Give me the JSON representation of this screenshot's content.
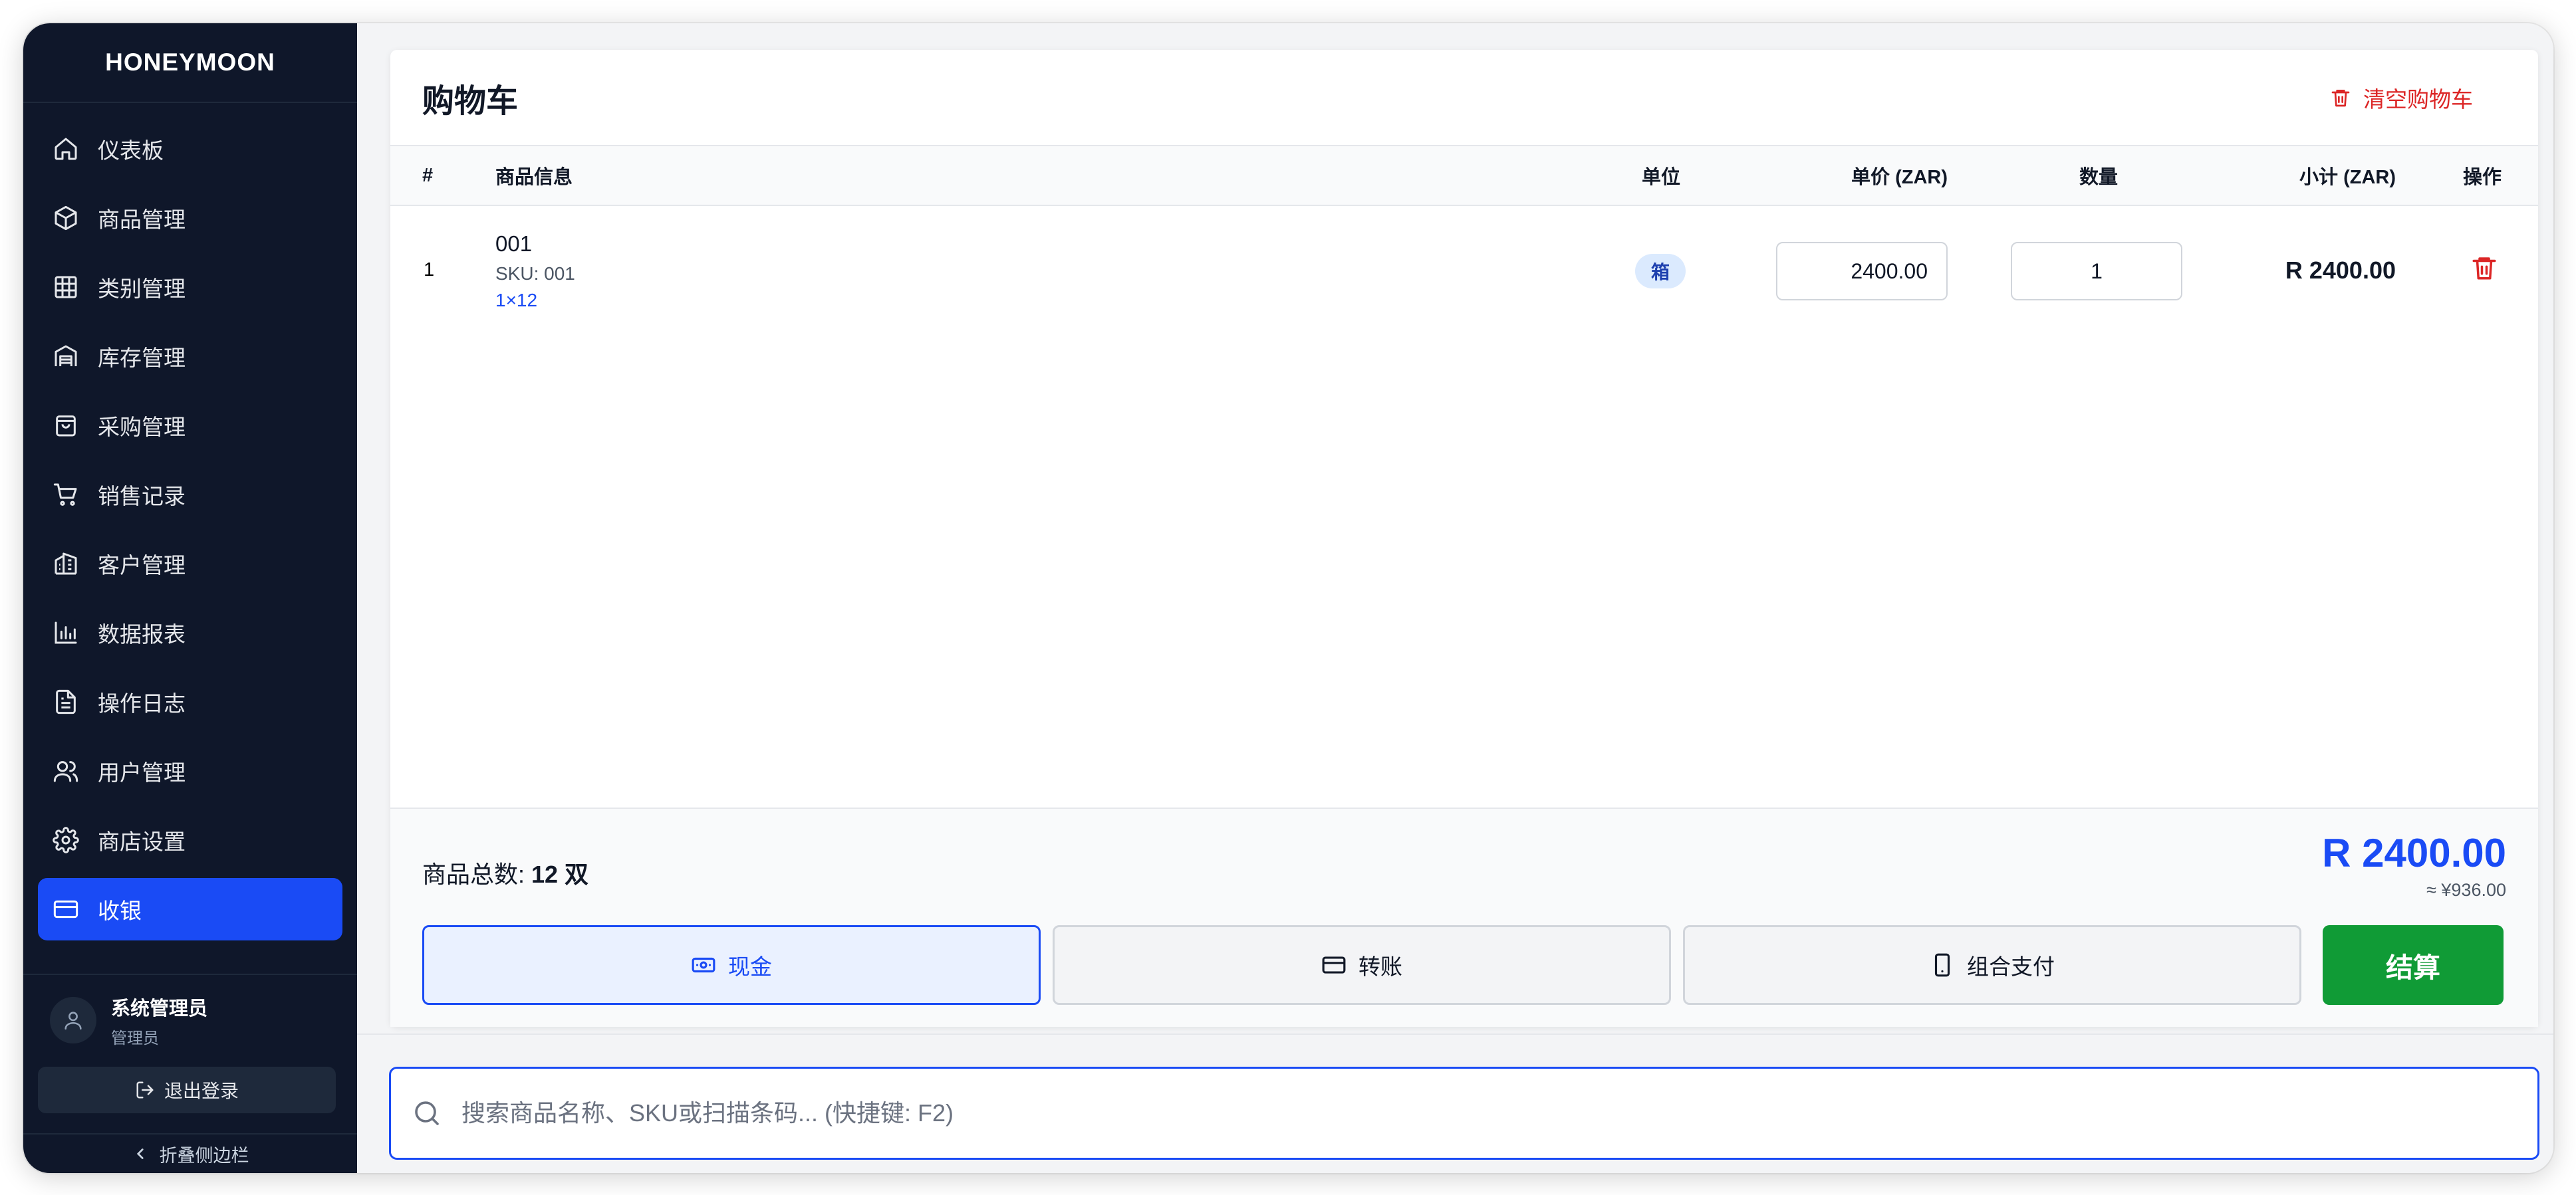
{
  "sidebar": {
    "brand": "HONEYMOON",
    "items": [
      {
        "label": "仪表板",
        "icon": "home-icon"
      },
      {
        "label": "商品管理",
        "icon": "box-icon"
      },
      {
        "label": "类别管理",
        "icon": "grid-icon"
      },
      {
        "label": "库存管理",
        "icon": "warehouse-icon"
      },
      {
        "label": "采购管理",
        "icon": "shopping-bag-icon"
      },
      {
        "label": "销售记录",
        "icon": "cart-icon"
      },
      {
        "label": "客户管理",
        "icon": "building-icon"
      },
      {
        "label": "数据报表",
        "icon": "bar-chart-icon"
      },
      {
        "label": "操作日志",
        "icon": "file-text-icon"
      },
      {
        "label": "用户管理",
        "icon": "users-icon"
      },
      {
        "label": "商店设置",
        "icon": "gear-icon"
      },
      {
        "label": "收银",
        "icon": "credit-card-icon",
        "active": true
      }
    ],
    "user": {
      "name": "系统管理员",
      "role": "管理员"
    },
    "logout_label": "退出登录",
    "collapse_label": "折叠侧边栏"
  },
  "cart": {
    "title": "购物车",
    "clear_label": "清空购物车",
    "columns": {
      "index": "#",
      "product": "商品信息",
      "unit": "单位",
      "price": "单价 (ZAR)",
      "quantity": "数量",
      "subtotal": "小计 (ZAR)",
      "action": "操作"
    },
    "rows": [
      {
        "index": "1",
        "name": "001",
        "sku": "SKU: 001",
        "pack": "1×12",
        "unit": "箱",
        "price": "2400.00",
        "quantity": "1",
        "subtotal": "R 2400.00"
      }
    ],
    "footer": {
      "count_label": "商品总数: ",
      "count_value": "12 双",
      "total": "R 2400.00",
      "total_cny": "≈ ¥936.00",
      "pay_methods": [
        "现金",
        "转账",
        "组合支付"
      ],
      "active_method": "现金",
      "checkout_label": "结算"
    }
  },
  "search": {
    "placeholder": "搜索商品名称、SKU或扫描条码... (快捷键: F2)",
    "value": ""
  },
  "colors": {
    "sidebar_bg": "#0f172a",
    "accent": "#1a4bf5",
    "danger": "#dc2626",
    "success": "#109b36"
  }
}
